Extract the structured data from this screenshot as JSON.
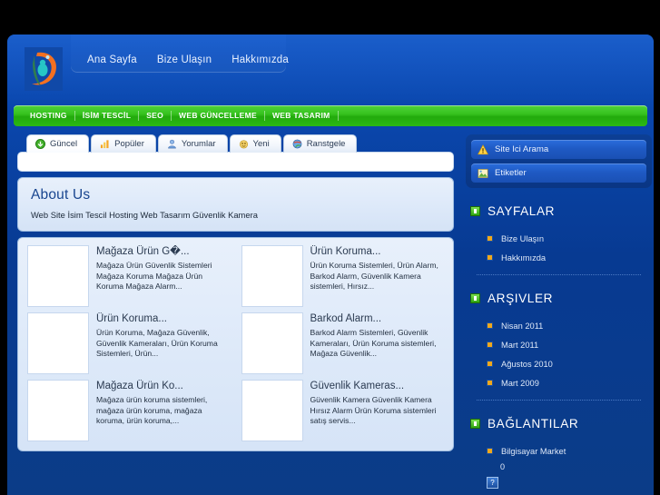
{
  "header": {
    "logo_alt": "site-logo",
    "nav": [
      {
        "label": "Ana Sayfa"
      },
      {
        "label": "Bize Ulaşın"
      },
      {
        "label": "Hakkımızda"
      }
    ]
  },
  "servicebar": {
    "items": [
      {
        "label": "HOSTING"
      },
      {
        "label": "İSİM TESCİL"
      },
      {
        "label": "SEO"
      },
      {
        "label": "WEB GÜNCELLEME"
      },
      {
        "label": "WEB TASARIM"
      }
    ]
  },
  "tabs": [
    {
      "label": "Güncel",
      "icon": "green-arrow-down-icon",
      "active": true
    },
    {
      "label": "Popüler",
      "icon": "bar-chart-icon",
      "active": false
    },
    {
      "label": "Yorumlar",
      "icon": "user-comment-icon",
      "active": false
    },
    {
      "label": "Yeni",
      "icon": "star-burst-icon",
      "active": false
    },
    {
      "label": "Ranstgele",
      "icon": "globe-icon",
      "active": false
    }
  ],
  "about": {
    "title": "About Us",
    "subtitle": "Web Site İsim Tescil Hosting Web Tasarım Güvenlik Kamera"
  },
  "cards": [
    {
      "title": "Mağaza Ürün G�...",
      "text": "Mağaza Ürün Güvenlik Sistemleri Mağaza Koruma Mağaza Ürün Koruma Mağaza Alarm..."
    },
    {
      "title": "Ürün Koruma...",
      "text": "Ürün Koruma Sistemleri, Ürün Alarm, Barkod Alarm, Güvenlik Kamera sistemleri,  Hırsız..."
    },
    {
      "title": "Ürün Koruma...",
      "text": "Ürün Koruma, Mağaza Güvenlik, Güvenlik Kameraları, Ürün Koruma Sistemleri, Ürün..."
    },
    {
      "title": "Barkod Alarm...",
      "text": "Barkod Alarm Sistemleri, Güvenlik Kameraları, Ürün Koruma sistemleri, Mağaza Güvenlik..."
    },
    {
      "title": "Mağaza Ürün Ko...",
      "text": "Mağaza ürün koruma sistemleri, mağaza ürün koruma, mağaza koruma, ürün koruma,..."
    },
    {
      "title": "Güvenlik Kameras...",
      "text": "Güvenlik Kamera Güvenlik Kamera Hırsız Alarm Ürün Koruma sistemleri satış servis..."
    }
  ],
  "sidebar": {
    "widgets": [
      {
        "label": "Site Ici Arama",
        "icon": "warning-triangle-icon"
      },
      {
        "label": "Etiketler",
        "icon": "image-tag-icon"
      }
    ],
    "sections": [
      {
        "title": "SAYFALAR",
        "items": [
          {
            "label": "Bize Ulaşın"
          },
          {
            "label": "Hakkımızda"
          }
        ]
      },
      {
        "title": "ARŞIVLER",
        "items": [
          {
            "label": "Nisan 2011"
          },
          {
            "label": "Mart 2011"
          },
          {
            "label": "Ağustos 2010"
          },
          {
            "label": "Mart 2009"
          }
        ]
      },
      {
        "title": "BAĞLANTILAR",
        "items": [
          {
            "label": "Bilgisayar Market"
          }
        ],
        "extra_value": "0"
      }
    ]
  },
  "colors": {
    "page_background": "#000000",
    "shell_blue": "#0a46ac",
    "deep_blue": "#0b3c87",
    "green_bar": "#2bb814",
    "panel_light": "#dde9f9",
    "heading_blue": "#18458f",
    "accent_orange": "#f0a81c"
  }
}
